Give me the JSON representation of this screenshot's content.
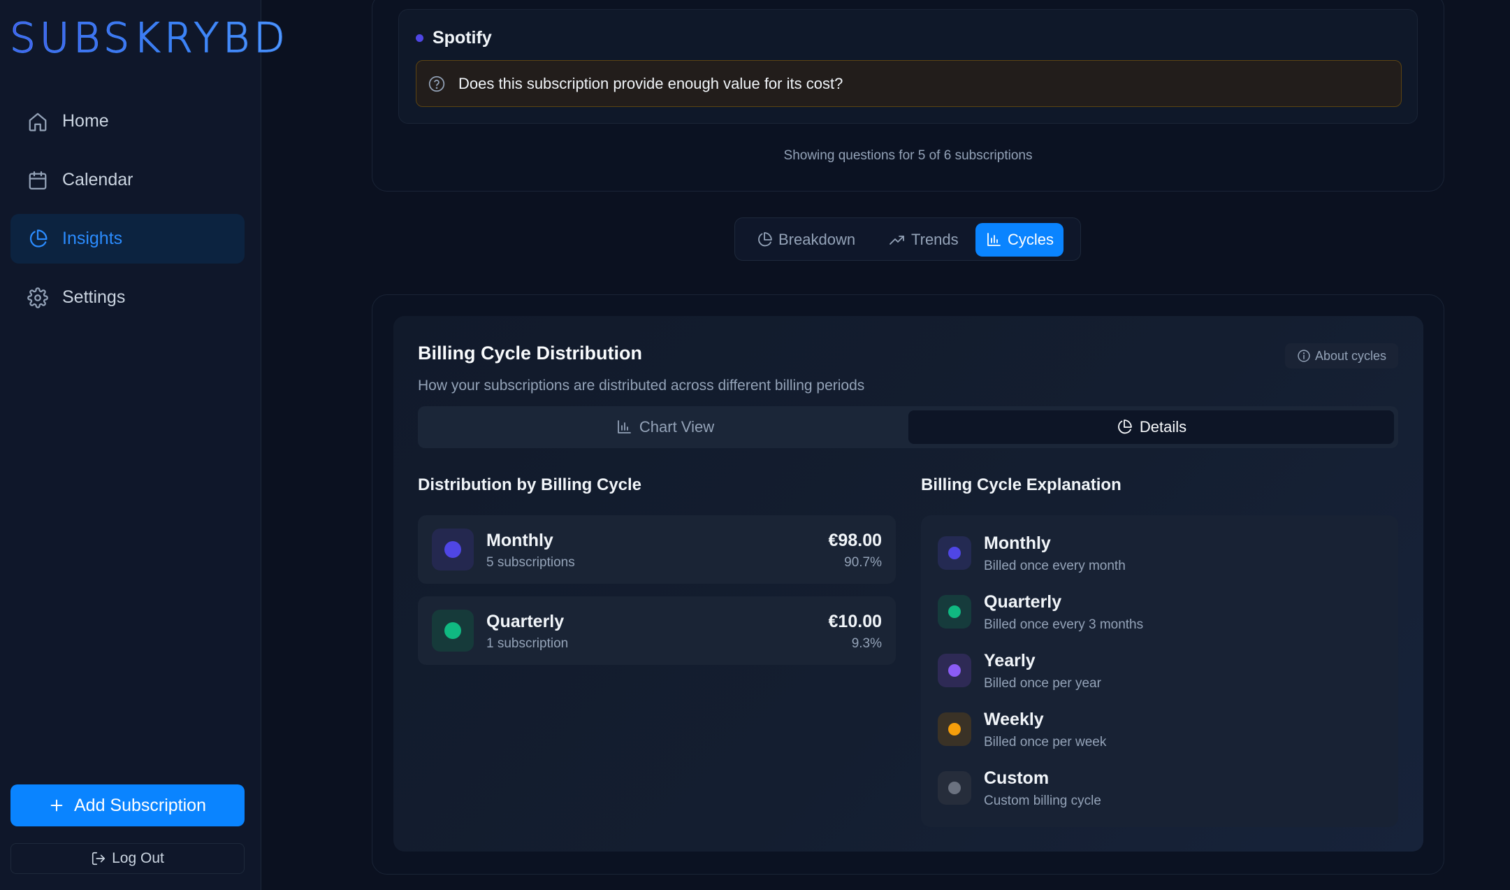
{
  "app": {
    "logo_text": "SUBSKRYBD"
  },
  "sidebar": {
    "items": [
      {
        "label": "Home",
        "icon": "home-icon"
      },
      {
        "label": "Calendar",
        "icon": "calendar-icon"
      },
      {
        "label": "Insights",
        "icon": "pie-chart-icon",
        "active": true
      },
      {
        "label": "Settings",
        "icon": "gear-icon"
      }
    ],
    "add_button": "Add Subscription",
    "logout_button": "Log Out"
  },
  "questions": {
    "subscription_name": "Spotify",
    "question_text": "Does this subscription provide enough value for its cost?",
    "footer": "Showing questions for 5 of 6 subscriptions"
  },
  "tabs": [
    {
      "label": "Breakdown",
      "icon": "pie-chart-icon"
    },
    {
      "label": "Trends",
      "icon": "trending-up-icon"
    },
    {
      "label": "Cycles",
      "icon": "bar-chart-icon",
      "active": true
    }
  ],
  "cycles": {
    "title": "Billing Cycle Distribution",
    "subtitle": "How your subscriptions are distributed across different billing periods",
    "about_button": "About cycles",
    "view_toggle": [
      {
        "label": "Chart View",
        "icon": "bar-chart-icon"
      },
      {
        "label": "Details",
        "icon": "pie-chart-icon",
        "active": true
      }
    ],
    "distribution_title": "Distribution by Billing Cycle",
    "distribution": [
      {
        "name": "Monthly",
        "count": "5 subscriptions",
        "amount": "€98.00",
        "percent": "90.7%",
        "color": "#4f46e5",
        "bg": "#24284f"
      },
      {
        "name": "Quarterly",
        "count": "1 subscription",
        "amount": "€10.00",
        "percent": "9.3%",
        "color": "#10b981",
        "bg": "#163a3a"
      }
    ],
    "explanation_title": "Billing Cycle Explanation",
    "explanations": [
      {
        "name": "Monthly",
        "desc": "Billed once every month",
        "color": "#4f46e5",
        "bg": "#242a52"
      },
      {
        "name": "Quarterly",
        "desc": "Billed once every 3 months",
        "color": "#10b981",
        "bg": "#163b3c"
      },
      {
        "name": "Yearly",
        "desc": "Billed once per year",
        "color": "#8b5cf6",
        "bg": "#2e2a55"
      },
      {
        "name": "Weekly",
        "desc": "Billed once per week",
        "color": "#f59e0b",
        "bg": "#3a3226"
      },
      {
        "name": "Custom",
        "desc": "Custom billing cycle",
        "color": "#6b7280",
        "bg": "#262d3b"
      }
    ]
  }
}
